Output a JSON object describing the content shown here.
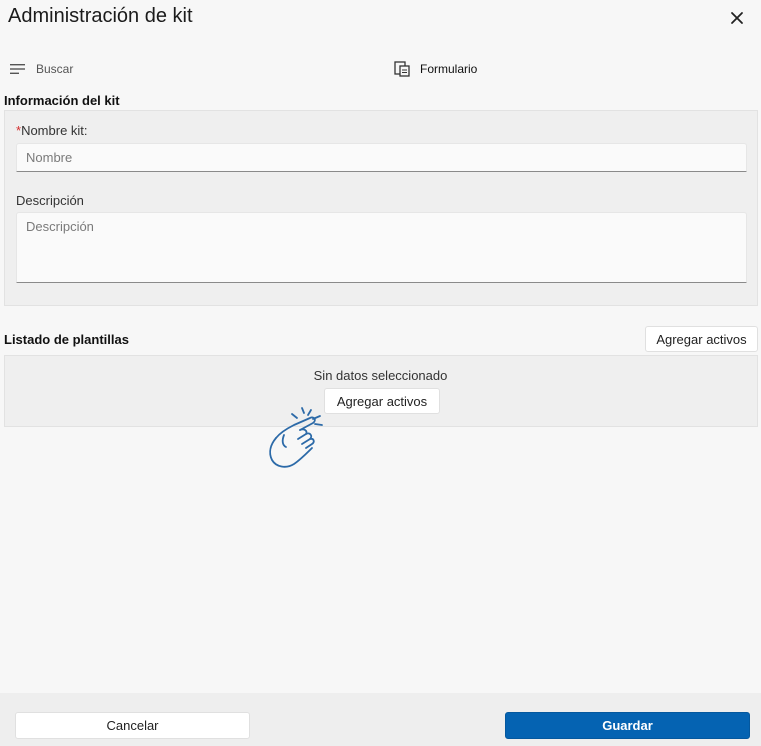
{
  "window": {
    "title": "Administración de kit"
  },
  "toolbar": {
    "search_label": "Buscar",
    "form_label": "Formulario"
  },
  "kit_info": {
    "section_title": "Información del kit",
    "name_required_mark": "*",
    "name_label": "Nombre kit:",
    "name_placeholder": "Nombre",
    "name_value": "",
    "description_label": "Descripción",
    "description_placeholder": "Descripción",
    "description_value": ""
  },
  "templates": {
    "section_title": "Listado de plantillas",
    "add_assets_label": "Agregar activos",
    "empty_message": "Sin datos seleccionado",
    "empty_add_assets_label": "Agregar activos"
  },
  "footer": {
    "cancel_label": "Cancelar",
    "save_label": "Guardar"
  },
  "icons": {
    "close": "close-icon",
    "search": "menu-lines-icon",
    "form": "form-document-icon",
    "pointer": "pointing-hand-icon"
  },
  "colors": {
    "primary": "#0563b2",
    "required": "#d32f2f",
    "hand_stroke": "#2c6aa8"
  }
}
